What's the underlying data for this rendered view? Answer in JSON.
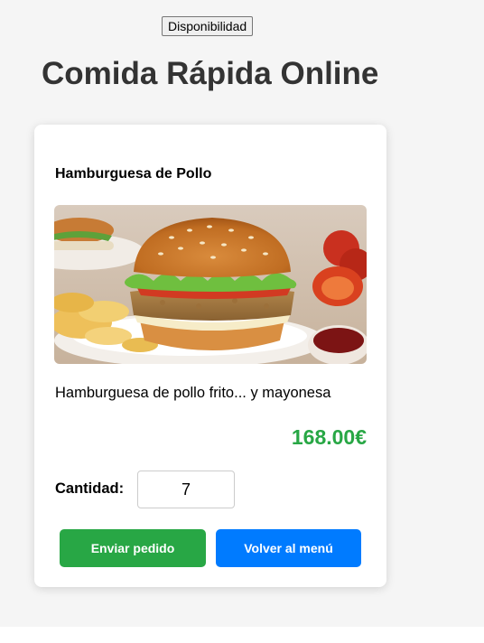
{
  "availability_button": {
    "label": "Disponibilidad"
  },
  "page": {
    "title": "Comida Rápida Online"
  },
  "product": {
    "name": "Hamburguesa de Pollo",
    "image_alt": "Hamburguesa de Pollo",
    "description": "Hamburguesa de pollo frito... y mayonesa",
    "price": "168.00€"
  },
  "quantity": {
    "label": "Cantidad:",
    "value": "7"
  },
  "actions": {
    "send_label": "Enviar pedido",
    "back_label": "Volver al menú"
  },
  "colors": {
    "price": "#28a745",
    "send_button": "#28a745",
    "back_button": "#007bff",
    "page_background": "#f5f5f5"
  }
}
